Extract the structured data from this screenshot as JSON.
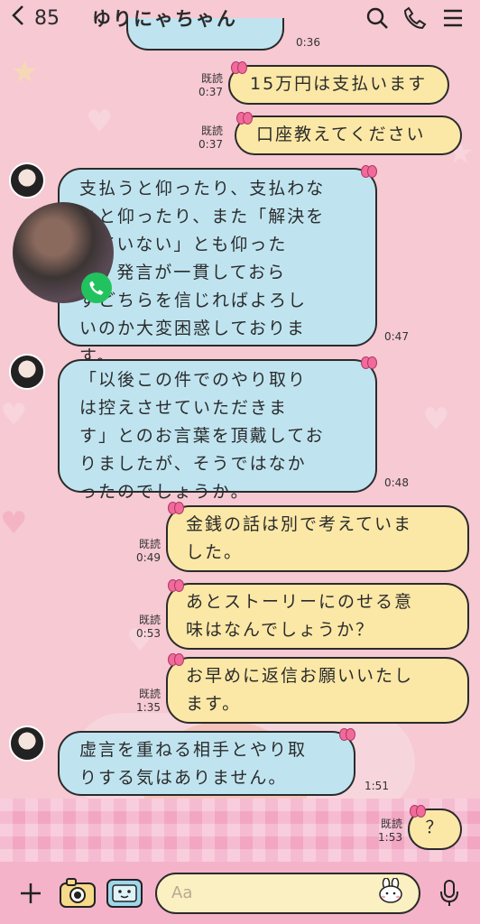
{
  "header": {
    "back_icon": "chevron-left-icon",
    "unread_count": "85",
    "title": "ゆりにゃちゃん"
  },
  "messages": [
    {
      "side": "out",
      "text": "15万円は支払います",
      "read": "既読",
      "time": "0:37"
    },
    {
      "side": "out",
      "text": "口座教えてください",
      "read": "既読",
      "time": "0:37"
    },
    {
      "side": "in",
      "text": "支払うと仰ったり、支払わな\nいと仰ったり、また「解決を\nしていない」とも仰った\nり、発言が一貫しておら\nずどちらを信じればよろし\nいのか大変困惑しておりま\nす。",
      "time": "0:47"
    },
    {
      "side": "in",
      "text": "「以後この件でのやり取り\nは控えさせていただきま\nす」とのお言葉を頂戴してお\nりましたが、そうではなか\nったのでしょうか。",
      "time": "0:48"
    },
    {
      "side": "out",
      "text": "金銭の話は別で考えていま\nした。",
      "read": "既読",
      "time": "0:49"
    },
    {
      "side": "out",
      "text": "あとストーリーにのせる意\n味はなんでしょうか？",
      "read": "既読",
      "time": "0:53"
    },
    {
      "side": "out",
      "text": "お早めに返信お願いいたし\nます。",
      "read": "既読",
      "time": "1:35"
    },
    {
      "side": "in",
      "text": "虚言を重ねる相手とやり取\nりする気はありません。",
      "time": "1:51"
    },
    {
      "side": "out",
      "text": "？",
      "read": "既読",
      "time": "1:53"
    }
  ],
  "partial_time_top": "0:36",
  "input": {
    "placeholder": "Aa"
  },
  "colors": {
    "bg": "#f6c9d3",
    "out_bubble": "#fbe8a6",
    "in_bubble": "#bfe4f0",
    "call_green": "#22c35e"
  }
}
